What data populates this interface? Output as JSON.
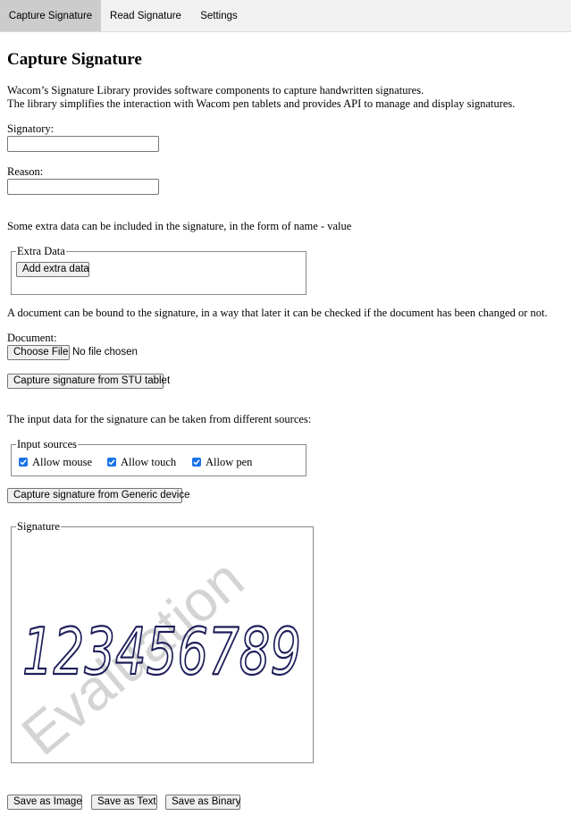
{
  "tabs": [
    {
      "label": "Capture Signature",
      "active": true
    },
    {
      "label": "Read Signature",
      "active": false
    },
    {
      "label": "Settings",
      "active": false
    }
  ],
  "page_title": "Capture Signature",
  "intro": [
    "Wacom’s Signature Library provides software components to capture handwritten signatures.",
    "The library simplifies the interaction with Wacom pen tablets and provides API to manage and display signatures."
  ],
  "signatory": {
    "label": "Signatory:",
    "value": ""
  },
  "reason": {
    "label": "Reason:",
    "value": ""
  },
  "extra_data_text": "Some extra data can be included in the signature, in the form of name - value",
  "extra_data": {
    "legend": "Extra Data",
    "add_button": "Add extra data"
  },
  "document_text": "A document can be bound to the signature, in a way that later it can be checked if the document has been changed or not.",
  "document": {
    "label": "Document:",
    "choose_button": "Choose File",
    "status": "No file chosen"
  },
  "capture_stu_button": "Capture signature from STU tablet",
  "input_sources_text": "The input data for the signature can be taken from different sources:",
  "input_sources": {
    "legend": "Input sources",
    "options": [
      {
        "label": "Allow mouse",
        "checked": true
      },
      {
        "label": "Allow touch",
        "checked": true
      },
      {
        "label": "Allow pen",
        "checked": true
      }
    ]
  },
  "capture_generic_button": "Capture signature from Generic device",
  "signature": {
    "legend": "Signature",
    "handwriting": "123456789",
    "watermark": "Evaluation"
  },
  "save_buttons": {
    "image": "Save as Image",
    "text": "Save as Text",
    "binary": "Save as Binary"
  },
  "colors": {
    "accent": "#1a73e8",
    "ink": "#1e1e5a",
    "watermark": "#d4d4d4",
    "tabbar": "#f1f1f1",
    "active_tab": "#cccccc"
  }
}
